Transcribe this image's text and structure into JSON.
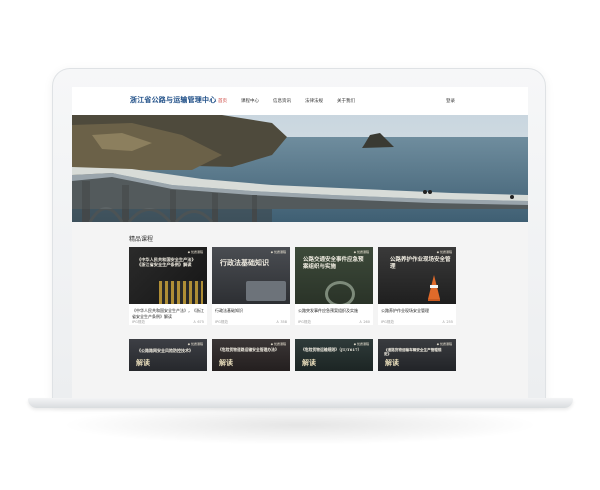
{
  "site": {
    "logo_text": "浙江省公路与运输管理中心",
    "nav": [
      "首页",
      "课程中心",
      "信息资讯",
      "法律法规",
      "关于我们"
    ],
    "active_nav": "首页",
    "login_label": "登录"
  },
  "section": {
    "title": "精品课程"
  },
  "cards": [
    {
      "badge": "◆ 优质课程",
      "thumb_title": "《中华人民共和国安全生产法》《浙江省安全生产条例》解读",
      "name": "《中华人民共和国安全生产法》，《浙江省安全生产条例》解读",
      "source": "IPG规范",
      "count": "675"
    },
    {
      "badge": "◆ 优质课程",
      "thumb_title": "行政法基础知识",
      "name": "行政法基础知识",
      "source": "IPG规范",
      "count": "358"
    },
    {
      "badge": "◆ 优质课程",
      "thumb_title": "公路交通安全事件应急预案组织与实施",
      "name": "公路突发事件应急预案组织及实施",
      "source": "IPG规范",
      "count": "260"
    },
    {
      "badge": "◆ 优质课程",
      "thumb_title": "公路养护作业现场安全管理",
      "name": "公路养护作业现场安全管理",
      "source": "IPG规范",
      "count": "255"
    },
    {
      "badge": "◆ 优质课程",
      "thumb_title": "《公路路网安全风险防控技术》",
      "jd": "解读"
    },
    {
      "badge": "◆ 优质课程",
      "thumb_title": "《危险货物道路运输安全管理办法》",
      "jd": "解读"
    },
    {
      "badge": "◆ 优质课程",
      "thumb_title": "《危险货物运输规则》（JT/T617）",
      "jd": "解读"
    },
    {
      "badge": "◆ 优质课程",
      "thumb_title": "《道路货物运输车辆安全生产管理规定》",
      "jd": "解读"
    }
  ],
  "colors": {
    "logo": "#1d4d86",
    "active": "#c8362f"
  },
  "icons": {
    "view_count": "person-icon"
  }
}
